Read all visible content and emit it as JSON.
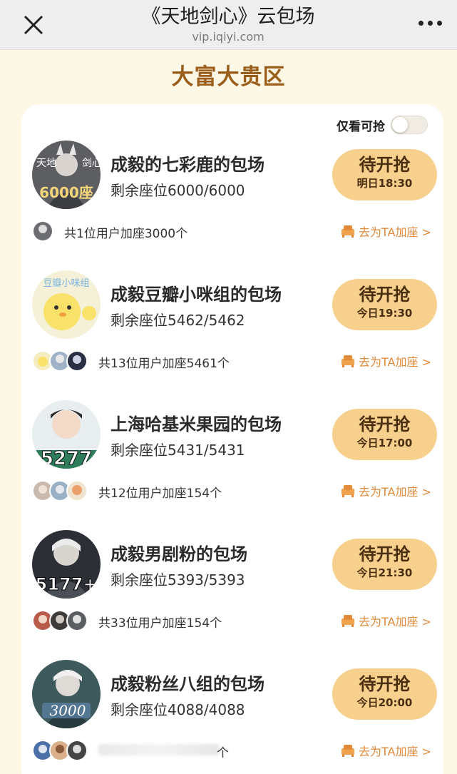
{
  "topbar": {
    "title": "《天地剑心》云包场",
    "url": "vip.iqiyi.com",
    "close_icon": "close-icon",
    "more_icon": "more-dots-icon"
  },
  "section_title": "大富大贵区",
  "filter": {
    "label": "仅看可抢",
    "enabled": false
  },
  "rooms": [
    {
      "name": "成毅的七彩鹿的包场",
      "seats": "剩余座位6000/6000",
      "button_label": "待开抢",
      "button_time": "明日18:30",
      "joined": "共1位用户加座3000个",
      "add_seat": "去为TA加座 >",
      "avatar_text": "6000座"
    },
    {
      "name": "成毅豆瓣小咪组的包场",
      "seats": "剩余座位5462/5462",
      "button_label": "待开抢",
      "button_time": "今日19:30",
      "joined": "共13位用户加座5461个",
      "add_seat": "去为TA加座 >",
      "avatar_text": "豆瓣小咪组"
    },
    {
      "name": "上海哈基米果园的包场",
      "seats": "剩余座位5431/5431",
      "button_label": "待开抢",
      "button_time": "今日17:00",
      "joined": "共12位用户加座154个",
      "add_seat": "去为TA加座 >",
      "avatar_text": "5277"
    },
    {
      "name": "成毅男剧粉的包场",
      "seats": "剩余座位5393/5393",
      "button_label": "待开抢",
      "button_time": "今日21:30",
      "joined": "共33位用户加座154个",
      "add_seat": "去为TA加座 >",
      "avatar_text": "5177+"
    },
    {
      "name": "成毅粉丝八组的包场",
      "seats": "剩余座位4088/4088",
      "button_label": "待开抢",
      "button_time": "今日20:00",
      "joined_tail": "个",
      "add_seat": "去为TA加座 >",
      "avatar_text": "3000"
    }
  ],
  "colors": {
    "page_bg": "#fdf7e6",
    "accent_brown": "#9a5e1a",
    "button_bg": "#f8d08d",
    "link_orange": "#e08a3a"
  }
}
